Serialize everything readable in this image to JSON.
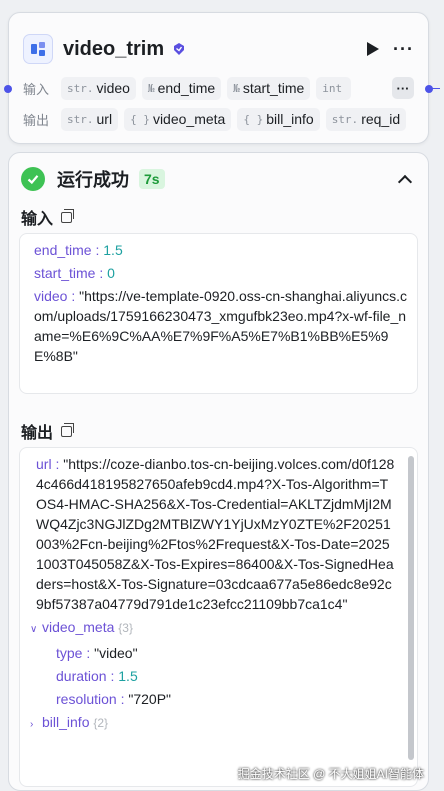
{
  "node": {
    "title": "video_trim",
    "inputs_label": "输入",
    "outputs_label": "输出",
    "inputs": [
      {
        "type": "str.",
        "name": "video"
      },
      {
        "type": "№",
        "name": "end_time"
      },
      {
        "type": "№",
        "name": "start_time"
      },
      {
        "type": "int",
        "name": ""
      }
    ],
    "outputs": [
      {
        "type": "str.",
        "name": "url"
      },
      {
        "type": "{ }",
        "name": "video_meta"
      },
      {
        "type": "{ }",
        "name": "bill_info"
      },
      {
        "type": "str.",
        "name": "req_id"
      }
    ],
    "more": "···",
    "menu": "···"
  },
  "run": {
    "status": "运行成功",
    "duration": "7s",
    "input_title": "输入",
    "output_title": "输出",
    "input": {
      "end_time_key": "end_time",
      "end_time_val": "1.5",
      "start_time_key": "start_time",
      "start_time_val": "0",
      "video_key": "video",
      "video_val": "\"https://ve-template-0920.oss-cn-shanghai.aliyuncs.com/uploads/1759166230473_xmgufbk23eo.mp4?x-wf-file_name=%E6%9C%AA%E7%9F%A5%E7%B1%BB%E5%9E%8B\""
    },
    "output": {
      "url_key": "url",
      "url_val": "\"https://coze-dianbo.tos-cn-beijing.volces.com/d0f1284c466d418195827650afeb9cd4.mp4?X-Tos-Algorithm=TOS4-HMAC-SHA256&X-Tos-Credential=AKLTZjdmMjI2MWQ4Zjc3NGJlZDg2MTBlZWY1YjUxMzY0ZTE%2F20251003%2Fcn-beijing%2Ftos%2Frequest&X-Tos-Date=20251003T045058Z&X-Tos-Expires=86400&X-Tos-SignedHeaders=host&X-Tos-Signature=03cdcaa677a5e86edc8e92c9bf57387a04779d791de1c23efcc21109bb7ca1c4\"",
      "video_meta_key": "video_meta",
      "video_meta_count": "{3}",
      "type_key": "type",
      "type_val": "\"video\"",
      "duration_key": "duration",
      "duration_val": "1.5",
      "resolution_key": "resolution",
      "resolution_val": "\"720P\"",
      "bill_info_key": "bill_info",
      "bill_info_count": "{2}"
    }
  },
  "watermark": "掘金技术社区 @ 不大姐姐AI智能体",
  "colors": {
    "accent": "#4d53e8",
    "success": "#3ec254",
    "key": "#6c52d6",
    "number": "#1ea1a1"
  }
}
